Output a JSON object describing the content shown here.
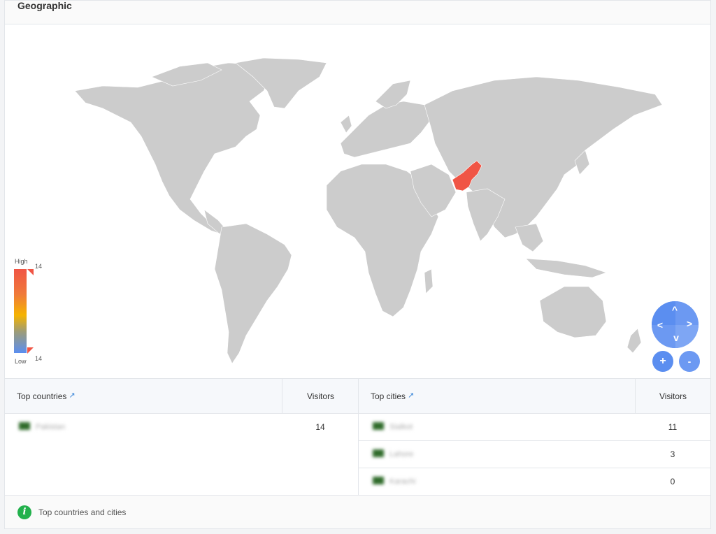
{
  "panel": {
    "title": "Geographic"
  },
  "legend": {
    "high_label": "High",
    "low_label": "Low",
    "max_value": "14",
    "min_value": "14"
  },
  "map": {
    "land_color": "#cccccc",
    "highlight_color": "#f05545",
    "highlighted_country": "Pakistan"
  },
  "nav": {
    "up": "^",
    "left": "<",
    "right": ">",
    "down": "v",
    "zoom_in": "+",
    "zoom_out": "-"
  },
  "countries_table": {
    "header": "Top countries",
    "visitors_header": "Visitors",
    "rows": [
      {
        "name": "Pakistan",
        "visitors": "14"
      }
    ]
  },
  "cities_table": {
    "header": "Top cities",
    "visitors_header": "Visitors",
    "rows": [
      {
        "name": "Sialkot",
        "visitors": "11"
      },
      {
        "name": "Lahore",
        "visitors": "3"
      },
      {
        "name": "Karachi",
        "visitors": "0"
      }
    ]
  },
  "footer": {
    "text": "Top countries and cities"
  }
}
